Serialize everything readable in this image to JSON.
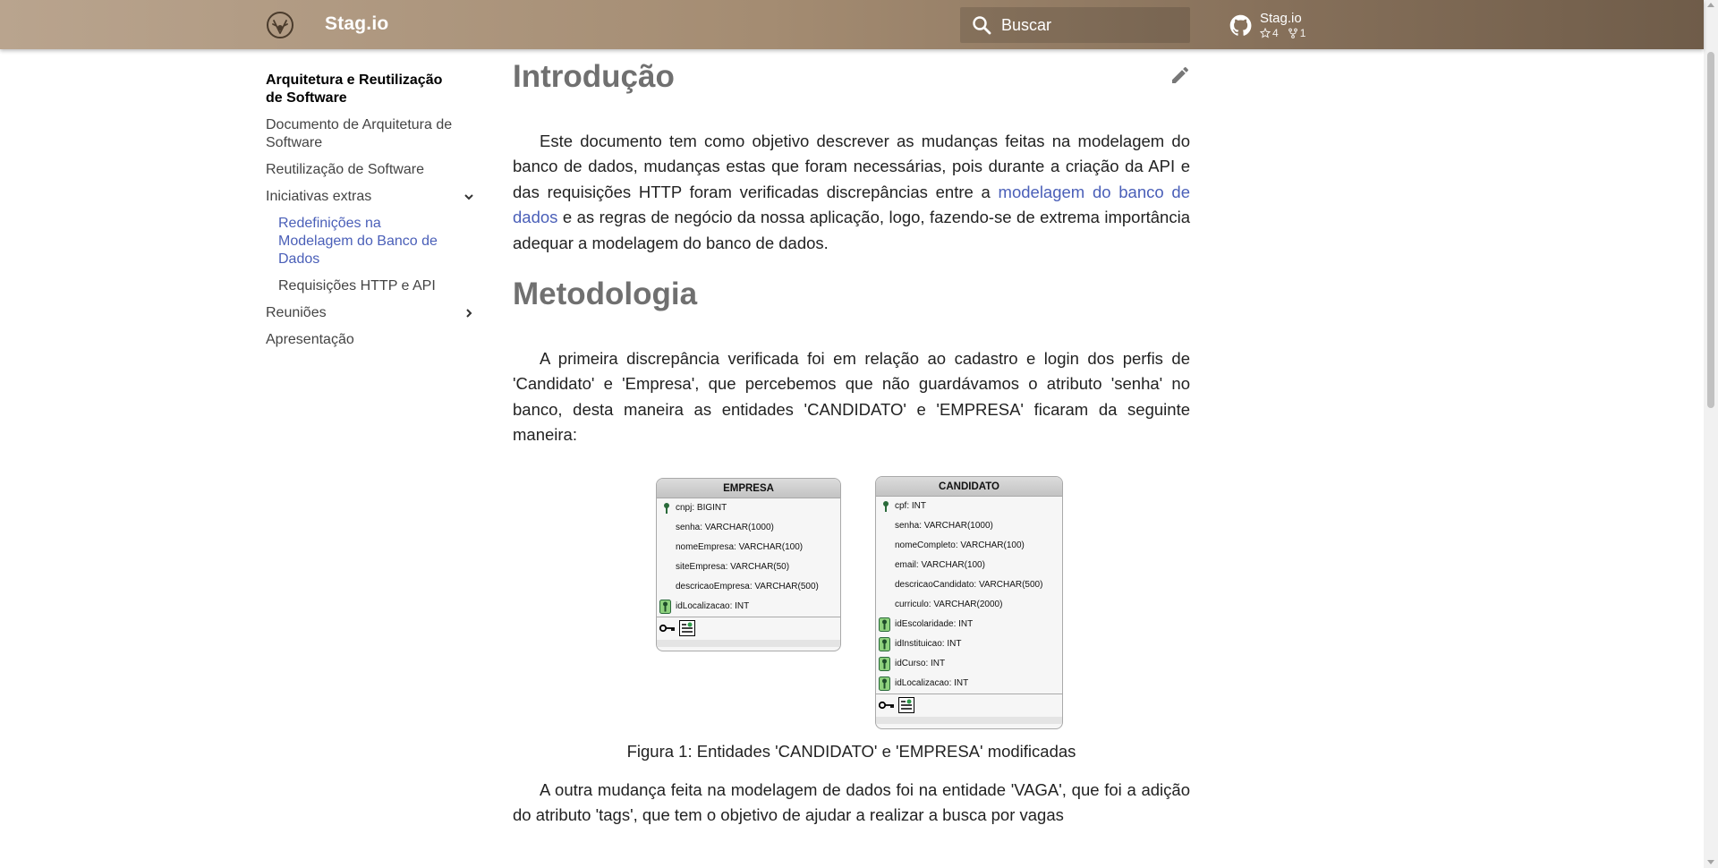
{
  "header": {
    "site_title": "Stag.io",
    "search_placeholder": "Buscar",
    "repo": {
      "name": "Stag.io",
      "stars": "4",
      "forks": "1"
    }
  },
  "sidebar": {
    "items": [
      {
        "label": "Arquitetura e Reutilização de Software"
      },
      {
        "label": "Documento de Arquitetura de Software"
      },
      {
        "label": "Reutilização de Software"
      },
      {
        "label": "Iniciativas extras"
      },
      {
        "label": "Redefinições na Modelagem do Banco de Dados"
      },
      {
        "label": "Requisições HTTP e API"
      },
      {
        "label": "Reuniões"
      },
      {
        "label": "Apresentação"
      }
    ]
  },
  "main": {
    "intro_title": "Introdução",
    "intro_text_1": "Este documento tem como objetivo descrever as mudanças feitas na modelagem do banco de dados, mudanças estas que foram necessárias, pois durante a criação da API e das requisições HTTP foram verificadas discrepâncias entre a ",
    "intro_link": "modelagem do banco de dados",
    "intro_text_2": " e as regras de negócio da nossa aplicação, logo, fazendo-se de extrema importância adequar a modelagem do banco de dados.",
    "method_title": "Metodologia",
    "method_text": "A primeira discrepância verificada foi em relação ao cadastro e login dos perfis de 'Candidato' e 'Empresa', que percebemos que não guardávamos o atributo 'senha' no banco, desta maneira as entidades 'CANDIDATO' e 'EMPRESA' ficaram da seguinte maneira:",
    "figure_caption": "Figura 1: Entidades 'CANDIDATO' e 'EMPRESA' modificadas",
    "vaga_text": "A outra mudança feita na modelagem de dados foi na entidade 'VAGA', que foi a adição do atributo 'tags', que tem o objetivo de ajudar a realizar a busca por vagas"
  },
  "figure": {
    "empresa": {
      "title": "EMPRESA",
      "rows": [
        "cnpj: BIGINT",
        "senha: VARCHAR(1000)",
        "nomeEmpresa: VARCHAR(100)",
        "siteEmpresa: VARCHAR(50)",
        "descricaoEmpresa: VARCHAR(500)",
        "idLocalizacao: INT"
      ]
    },
    "candidato": {
      "title": "CANDIDATO",
      "rows": [
        "cpf: INT",
        "senha: VARCHAR(1000)",
        "nomeCompleto: VARCHAR(100)",
        "email: VARCHAR(100)",
        "descricaoCandidato: VARCHAR(500)",
        "curriculo: VARCHAR(2000)",
        "idEscolaridade: INT",
        "idInstituicao: INT",
        "idCurso: INT",
        "idLocalizacao: INT"
      ]
    }
  },
  "colors": {
    "link": "#4a5fb8",
    "heading": "#707070",
    "header_start": "#b9a48e",
    "header_end": "#6f5c49"
  }
}
